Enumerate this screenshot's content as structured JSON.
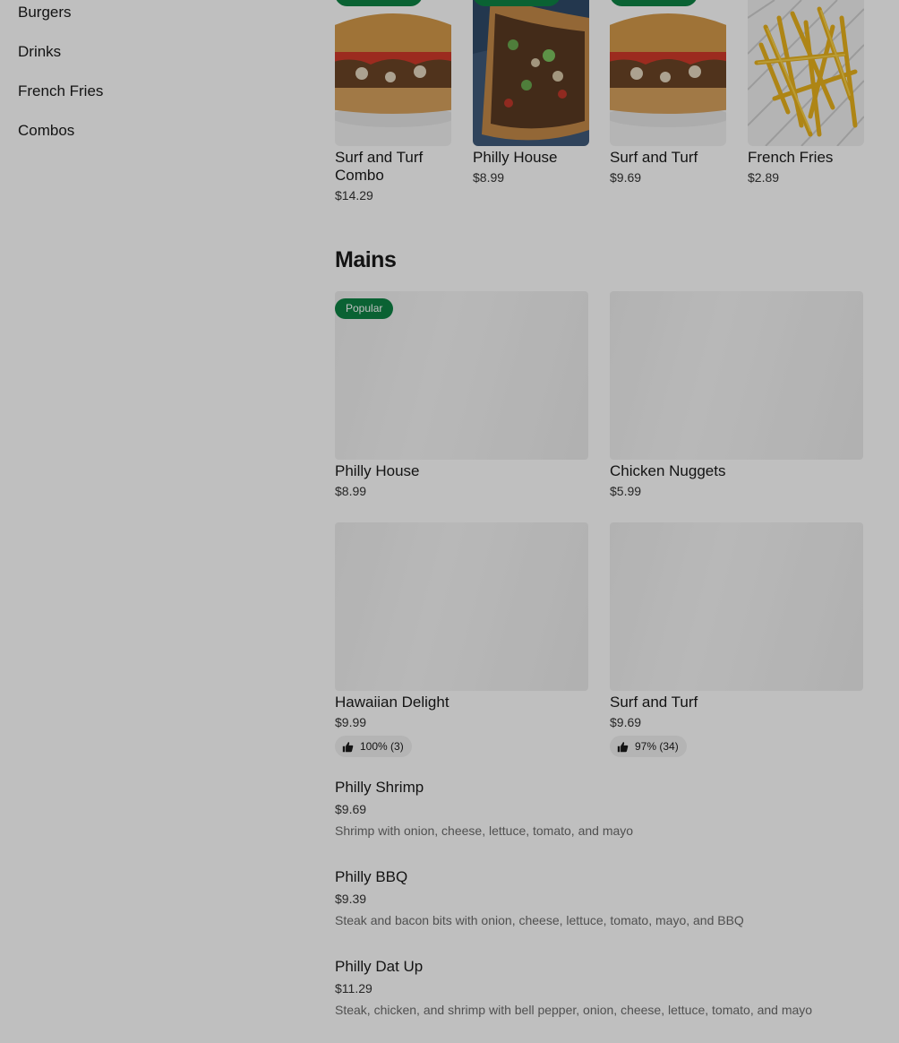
{
  "sidebar": {
    "items": [
      {
        "label": "Burgers"
      },
      {
        "label": "Drinks"
      },
      {
        "label": "French Fries"
      },
      {
        "label": "Combos"
      }
    ]
  },
  "featured": [
    {
      "name": "Surf and Turf Combo",
      "price": "$14.29"
    },
    {
      "name": "Philly House",
      "price": "$8.99"
    },
    {
      "name": "Surf and Turf",
      "price": "$9.69"
    },
    {
      "name": "French Fries",
      "price": "$2.89"
    }
  ],
  "section": {
    "title": "Mains",
    "cards": [
      {
        "name": "Philly House",
        "price": "$8.99",
        "badge": "Popular"
      },
      {
        "name": "Chicken Nuggets",
        "price": "$5.99"
      },
      {
        "name": "Hawaiian Delight",
        "price": "$9.99",
        "rating": "100% (3)"
      },
      {
        "name": "Surf and Turf",
        "price": "$9.69",
        "rating": "97% (34)"
      }
    ],
    "list": [
      {
        "name": "Philly Shrimp",
        "price": "$9.69",
        "desc": "Shrimp with onion, cheese, lettuce, tomato, and mayo"
      },
      {
        "name": "Philly BBQ",
        "price": "$9.39",
        "desc": "Steak and bacon bits with onion, cheese, lettuce, tomato, mayo, and BBQ"
      },
      {
        "name": "Philly Dat Up",
        "price": "$11.29",
        "desc": "Steak, chicken, and shrimp with bell pepper, onion, cheese, lettuce, tomato, and mayo"
      }
    ]
  },
  "colors": {
    "badge": "#0e8345",
    "overlay": "rgba(0,0,0,0.25)"
  },
  "icons": {
    "rating": "thumbs-up-icon"
  }
}
